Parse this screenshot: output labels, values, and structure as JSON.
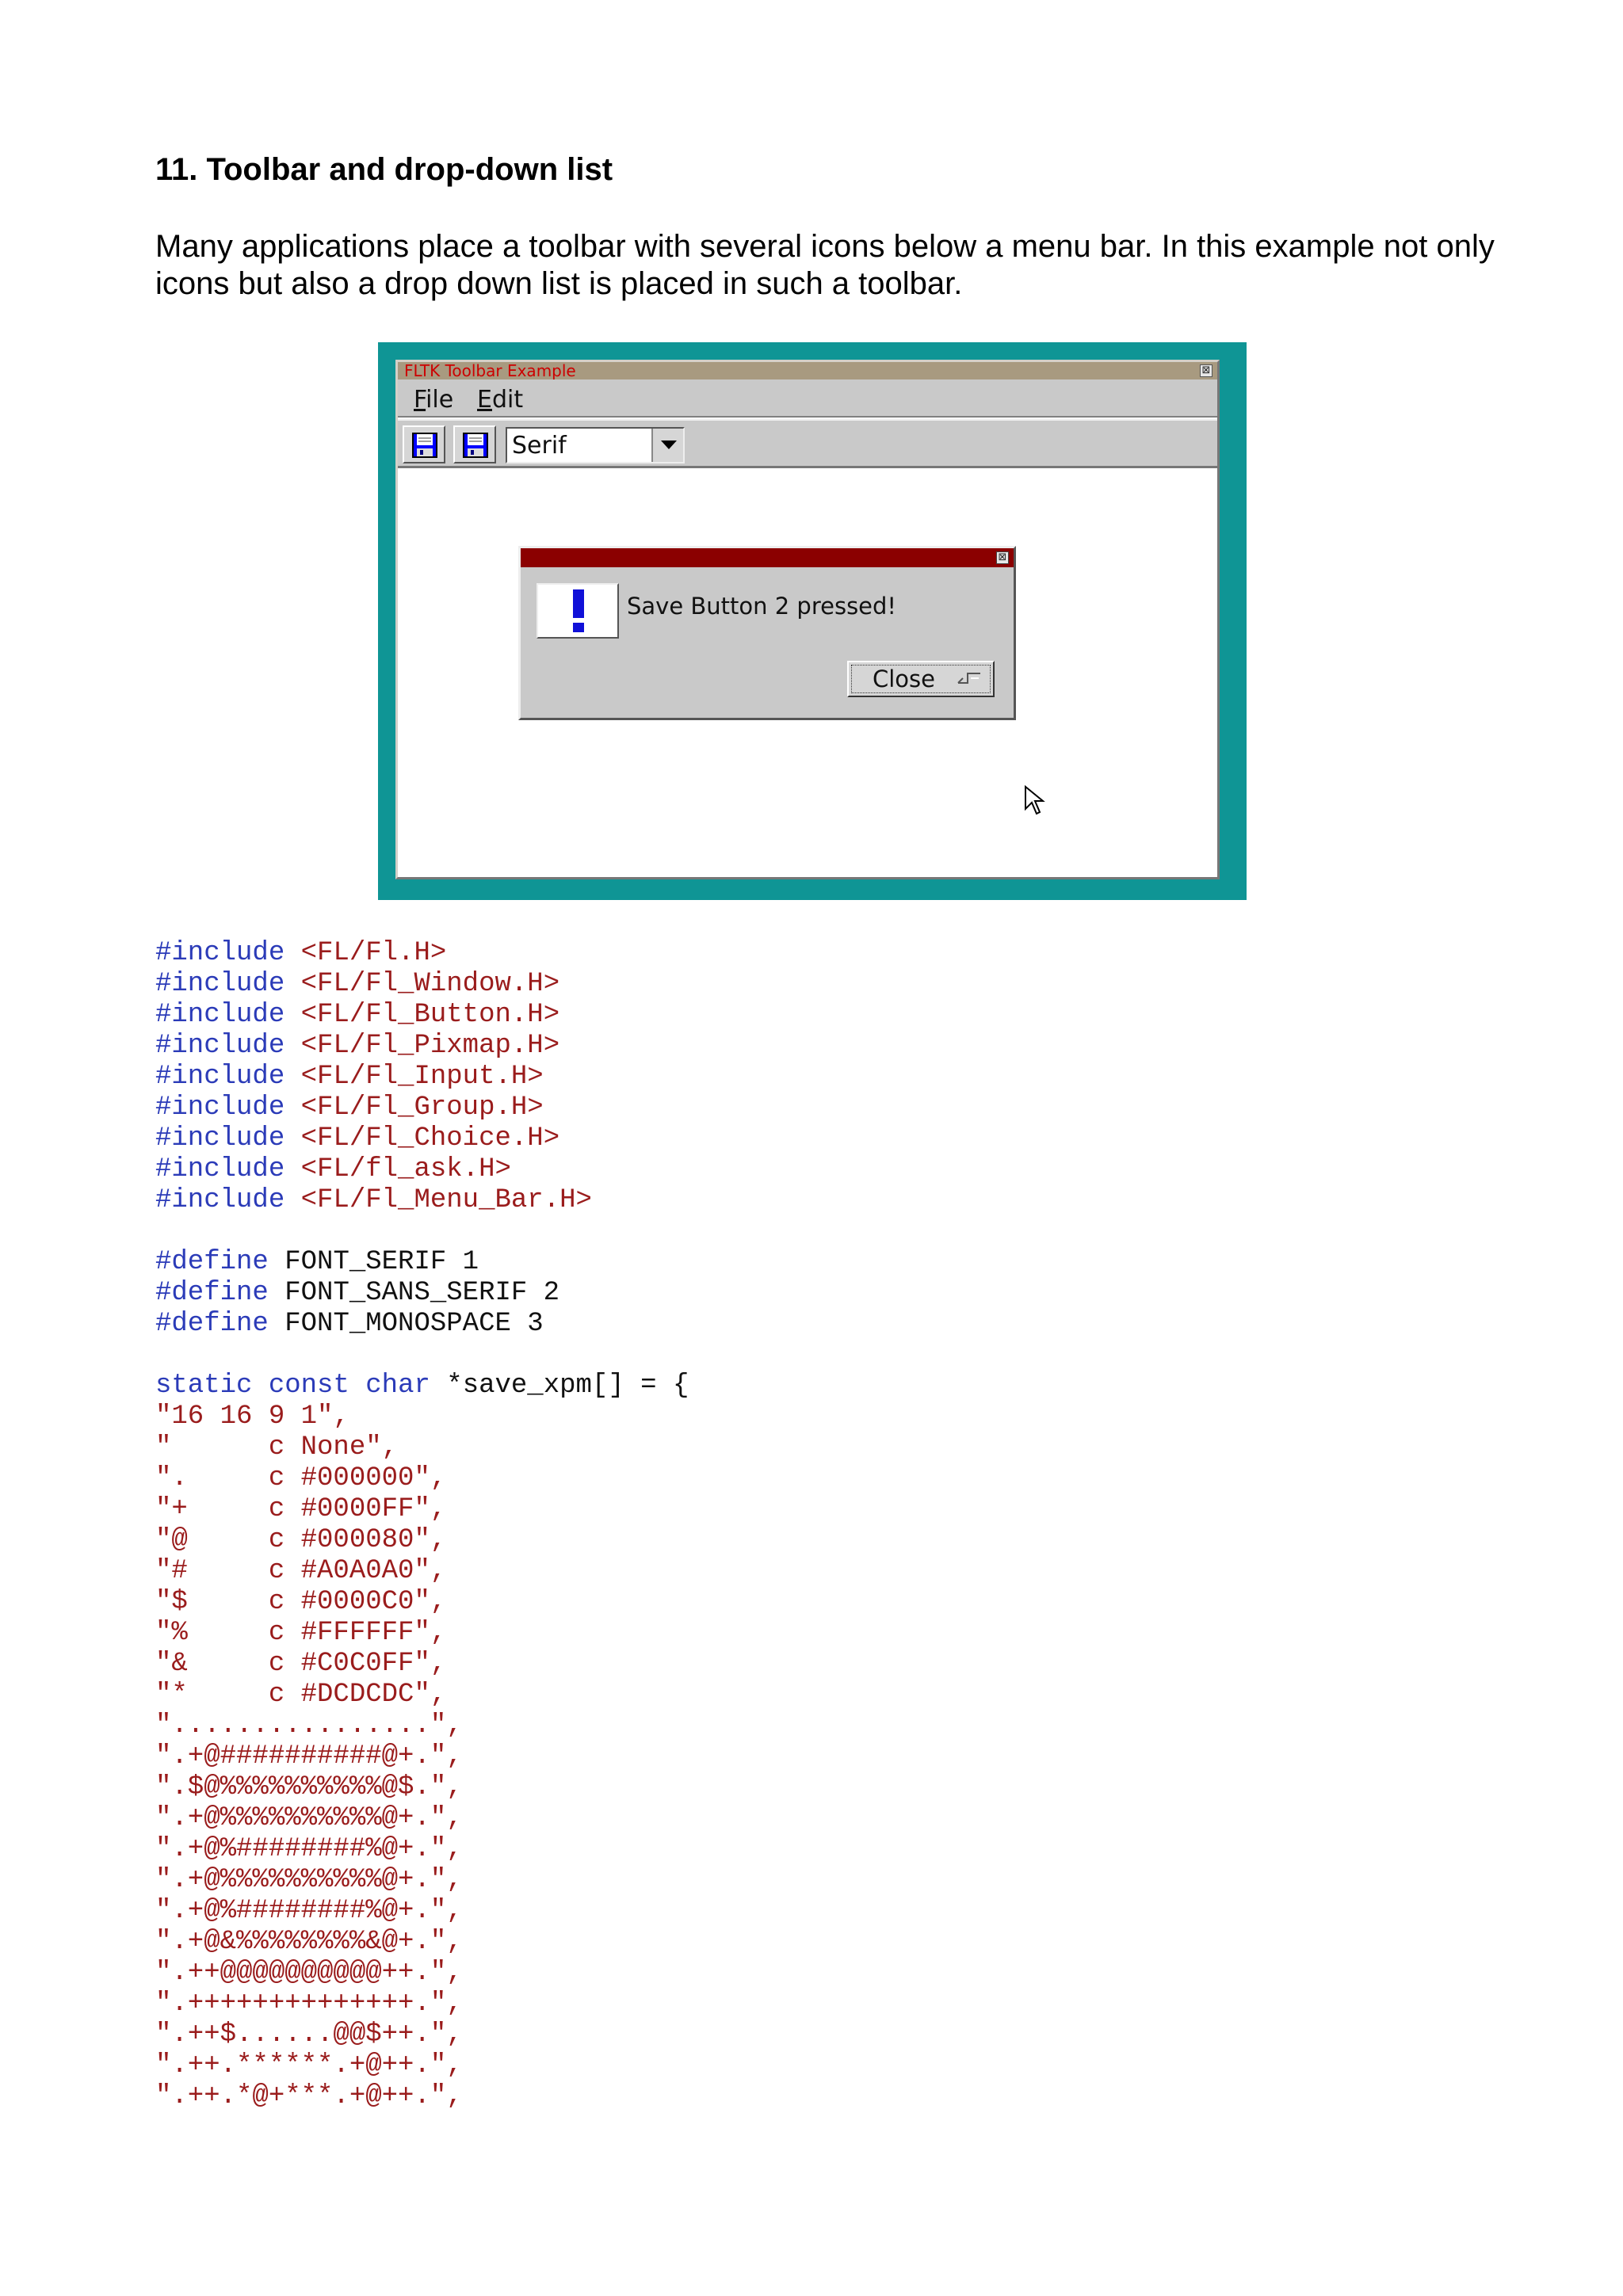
{
  "heading": "11. Toolbar and drop-down list",
  "intro": "Many applications place a toolbar with several icons below a menu bar. In this example not only icons but also a drop down list is placed in such a toolbar.",
  "screenshot": {
    "window_title": "FLTK Toolbar Example",
    "close_glyph": "⊠",
    "menu": [
      {
        "label": "File",
        "mnemonic": "F"
      },
      {
        "label": "Edit",
        "mnemonic": "E"
      }
    ],
    "toolbar": {
      "save_icon_1": "save-icon",
      "save_icon_2": "save-icon",
      "font_choice": "Serif"
    },
    "dialog": {
      "message": "Save Button 2 pressed!",
      "button": "Close",
      "icon": "exclamation-icon"
    },
    "colors": {
      "frame": "#0f9595",
      "titlebar": "#a89a80",
      "title_text": "#cc0000",
      "dialog_title": "#8b0000",
      "alert_blue": "#1010d8"
    }
  },
  "code": {
    "includes": [
      {
        "kw": "#include",
        "rest": " <FL/Fl.H>"
      },
      {
        "kw": "#include",
        "rest": " <FL/Fl_Window.H>"
      },
      {
        "kw": "#include",
        "rest": " <FL/Fl_Button.H>"
      },
      {
        "kw": "#include",
        "rest": " <FL/Fl_Pixmap.H>"
      },
      {
        "kw": "#include",
        "rest": " <FL/Fl_Input.H>"
      },
      {
        "kw": "#include",
        "rest": " <FL/Fl_Group.H>"
      },
      {
        "kw": "#include",
        "rest": " <FL/Fl_Choice.H>"
      },
      {
        "kw": "#include",
        "rest": " <FL/fl_ask.H>"
      },
      {
        "kw": "#include",
        "rest": " <FL/Fl_Menu_Bar.H>"
      }
    ],
    "defines": [
      {
        "kw": "#define",
        "rest": " FONT_SERIF 1"
      },
      {
        "kw": "#define",
        "rest": " FONT_SANS_SERIF 2"
      },
      {
        "kw": "#define",
        "rest": " FONT_MONOSPACE 3"
      }
    ],
    "decl": {
      "kw1": "static",
      "kw2": "const",
      "kw3": "char",
      "rest": " *save_xpm[] = {"
    },
    "xpm_lines": [
      "\"16 16 9 1\",",
      "\"      c None\",",
      "\".     c #000000\",",
      "\"+     c #0000FF\",",
      "\"@     c #000080\",",
      "\"#     c #A0A0A0\",",
      "\"$     c #0000C0\",",
      "\"%     c #FFFFFF\",",
      "\"&     c #C0C0FF\",",
      "\"*     c #DCDCDC\",",
      "\"................\",",
      "\".+@##########@+.\",",
      "\".$@%%%%%%%%%%@$.\",",
      "\".+@%%%%%%%%%%@+.\",",
      "\".+@%########%@+.\",",
      "\".+@%%%%%%%%%%@+.\",",
      "\".+@%########%@+.\",",
      "\".+@&%%%%%%%%&@+.\",",
      "\".++@@@@@@@@@@++.\",",
      "\".++++++++++++++.\",",
      "\".++$......@@$++.\",",
      "\".++.******.+@++.\",",
      "\".++.*@+***.+@++.\","
    ]
  }
}
